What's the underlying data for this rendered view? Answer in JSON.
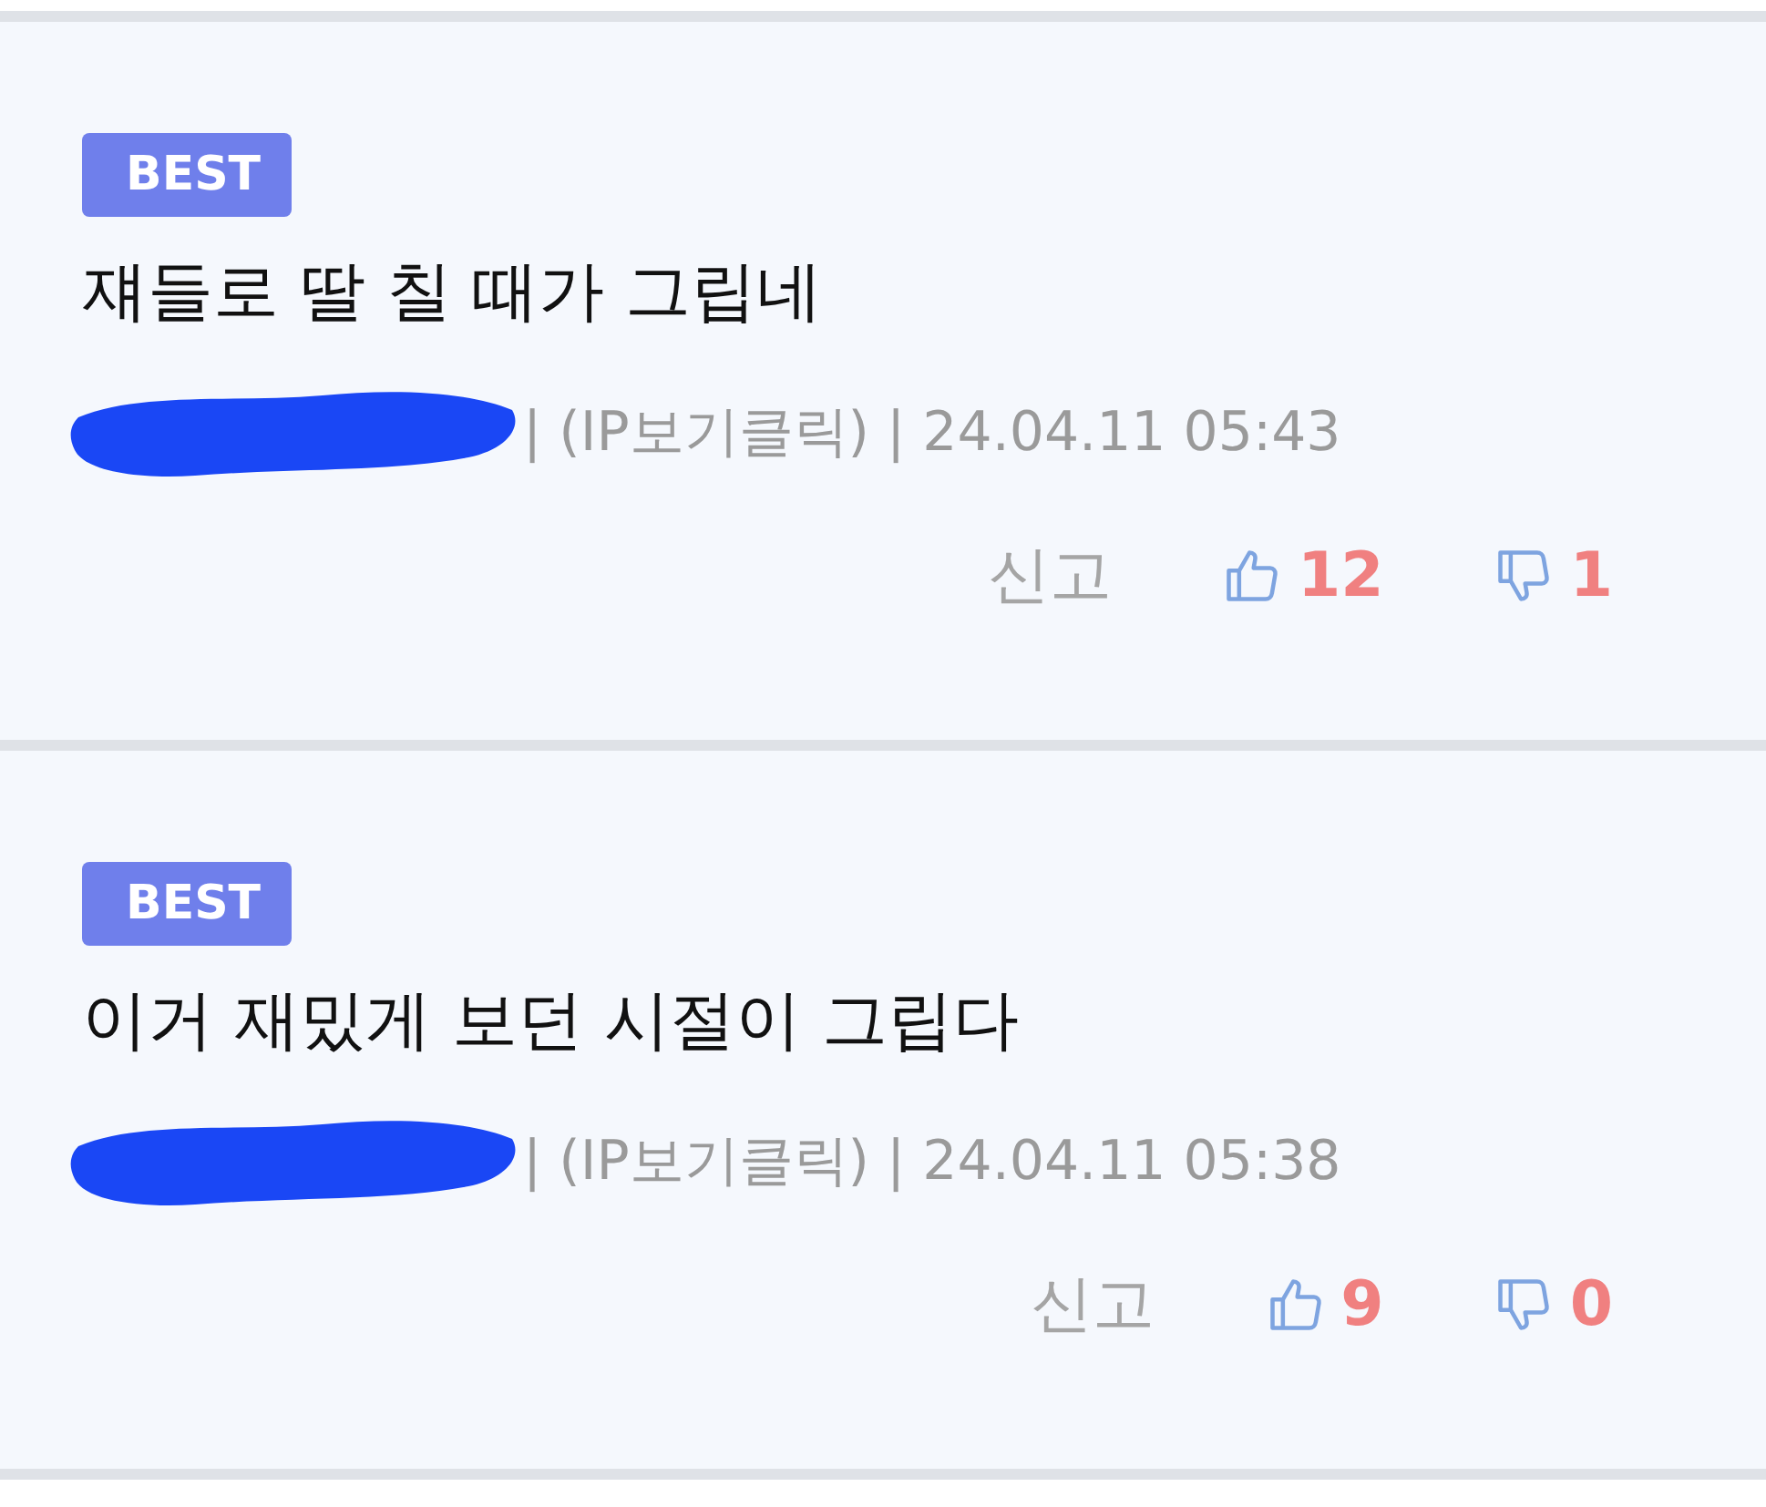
{
  "comments": [
    {
      "badge": "BEST",
      "text": "쟤들로 딸 칠 때가 그립네",
      "author_redacted": true,
      "ip": "| (IP보기클릭) | 24.04.11 05:43",
      "report": "신고",
      "likes": "12",
      "dislikes": "1"
    },
    {
      "badge": "BEST",
      "text": "이거 재밌게 보던 시절이 그립다",
      "author_redacted": true,
      "ip": "| (IP보기클릭) | 24.04.11 05:38",
      "report": "신고",
      "likes": "9",
      "dislikes": "0"
    }
  ]
}
